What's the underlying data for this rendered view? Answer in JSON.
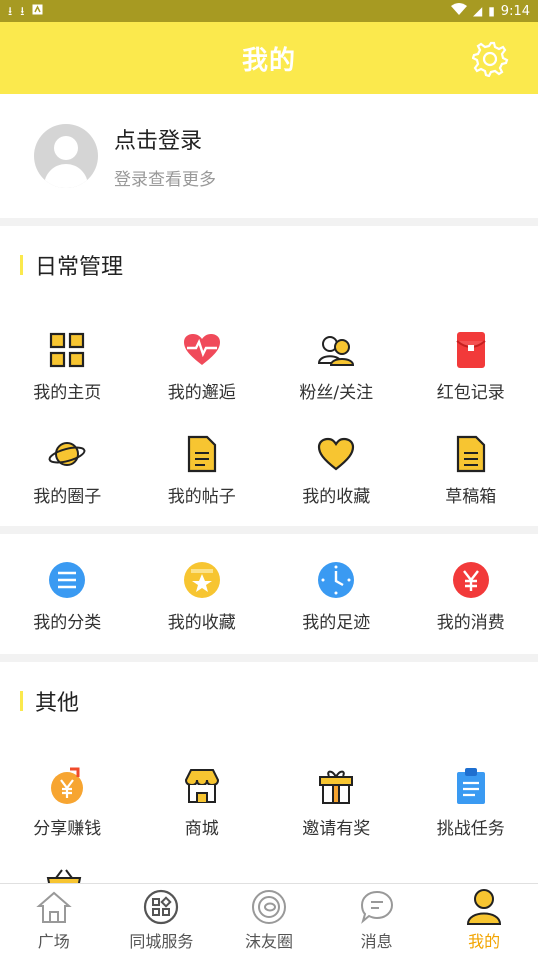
{
  "status_bar": {
    "time": "9:14",
    "battery_glyph": "▮",
    "download_glyph": "⭳",
    "signal_glyph": "◢"
  },
  "header": {
    "title": "我的"
  },
  "login": {
    "title": "点击登录",
    "subtitle": "登录查看更多"
  },
  "daily": {
    "title": "日常管理",
    "items": [
      {
        "label": "我的主页",
        "icon": "grid-icon"
      },
      {
        "label": "我的邂逅",
        "icon": "heartbeat-icon"
      },
      {
        "label": "粉丝/关注",
        "icon": "people-icon"
      },
      {
        "label": "红包记录",
        "icon": "red-packet-icon"
      },
      {
        "label": "我的圈子",
        "icon": "planet-icon"
      },
      {
        "label": "我的帖子",
        "icon": "document-icon"
      },
      {
        "label": "我的收藏",
        "icon": "heart-icon"
      },
      {
        "label": "草稿箱",
        "icon": "draft-icon"
      }
    ]
  },
  "extras": {
    "items": [
      {
        "label": "我的分类",
        "icon": "list-circle-icon"
      },
      {
        "label": "我的收藏",
        "icon": "star-box-icon"
      },
      {
        "label": "我的足迹",
        "icon": "clock-icon"
      },
      {
        "label": "我的消费",
        "icon": "yen-icon"
      }
    ]
  },
  "other": {
    "title": "其他",
    "items": [
      {
        "label": "分享赚钱",
        "icon": "share-money-icon"
      },
      {
        "label": "商城",
        "icon": "shop-icon"
      },
      {
        "label": "邀请有奖",
        "icon": "gift-icon"
      },
      {
        "label": "挑战任务",
        "icon": "clipboard-icon"
      }
    ]
  },
  "tabbar": {
    "tabs": [
      {
        "label": "广场",
        "icon": "home-icon"
      },
      {
        "label": "同城服务",
        "icon": "services-icon"
      },
      {
        "label": "沫友圈",
        "icon": "circle-icon"
      },
      {
        "label": "消息",
        "icon": "message-icon"
      },
      {
        "label": "我的",
        "icon": "user-icon",
        "active": true
      }
    ]
  },
  "colors": {
    "brand_yellow": "#fbe94d",
    "status_bar": "#a79a22",
    "active_tab": "#f2a400"
  }
}
